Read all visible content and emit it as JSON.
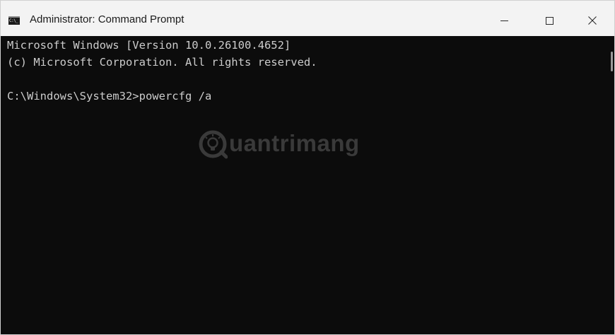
{
  "window": {
    "title": "Administrator: Command Prompt",
    "app_icon_text": "C:\\_"
  },
  "title_controls": {
    "minimize": "minimize",
    "maximize": "maximize",
    "close": "close"
  },
  "console": {
    "lines": [
      "Microsoft Windows [Version 10.0.26100.4652]",
      "(c) Microsoft Corporation. All rights reserved.",
      "C:\\Windows\\System32>powercfg /a"
    ]
  },
  "watermark": {
    "text": "uantrimang"
  },
  "colors": {
    "console_bg": "#0c0c0c",
    "console_text": "#cccccc",
    "titlebar_bg": "#f3f3f3"
  }
}
